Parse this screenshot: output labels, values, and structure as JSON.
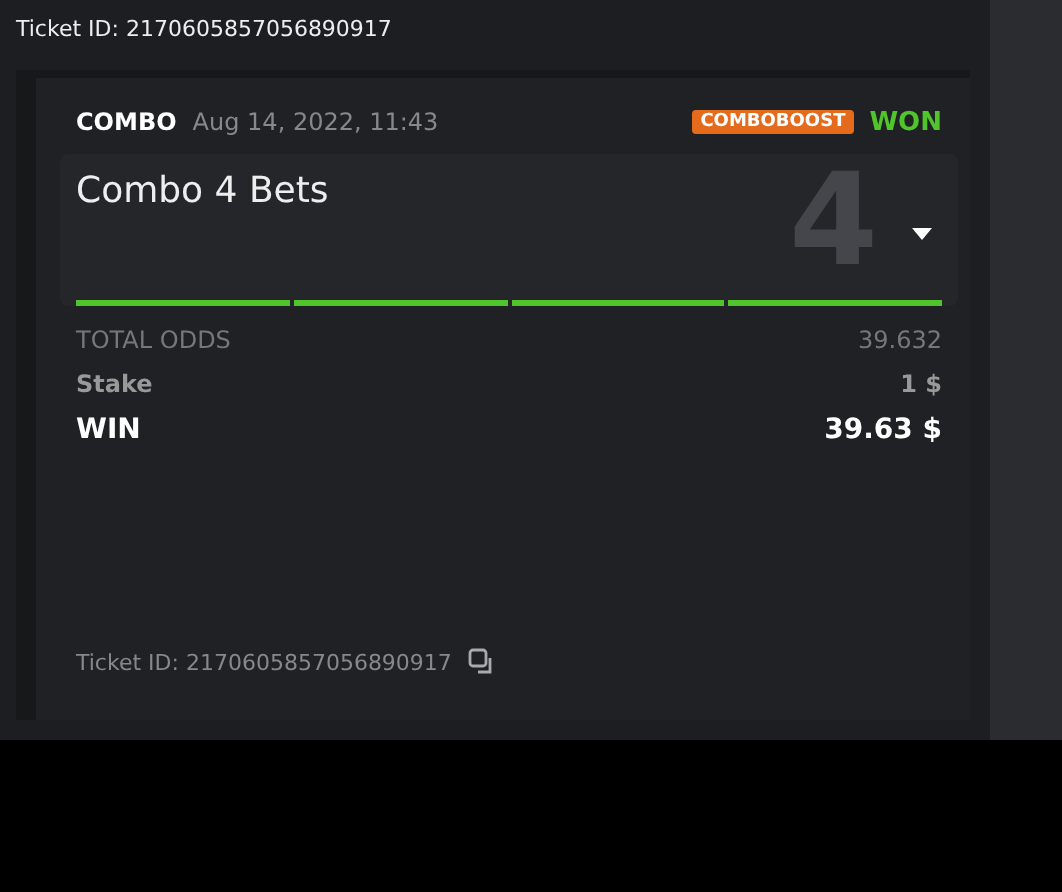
{
  "header": {
    "ticket_id": "Ticket ID: 2170605857056890917"
  },
  "bet": {
    "type": "COMBO",
    "date": "Aug 14, 2022, 11:43",
    "badge": "COMBOBOOST",
    "status": "WON",
    "won": true,
    "title": "Combo 4 Bets",
    "count": "4",
    "expanded": false,
    "legs": [
      {
        "won": true
      },
      {
        "won": true
      },
      {
        "won": true
      },
      {
        "won": true
      }
    ],
    "rows": [
      {
        "kind": "odds",
        "label": "TOTAL ODDS",
        "value": "39.632"
      },
      {
        "kind": "stake",
        "label": "Stake",
        "value": "1 $"
      },
      {
        "kind": "win",
        "label": "WIN",
        "value": "39.63 $"
      }
    ],
    "ticket_id": "Ticket ID: 2170605857056890917"
  }
}
